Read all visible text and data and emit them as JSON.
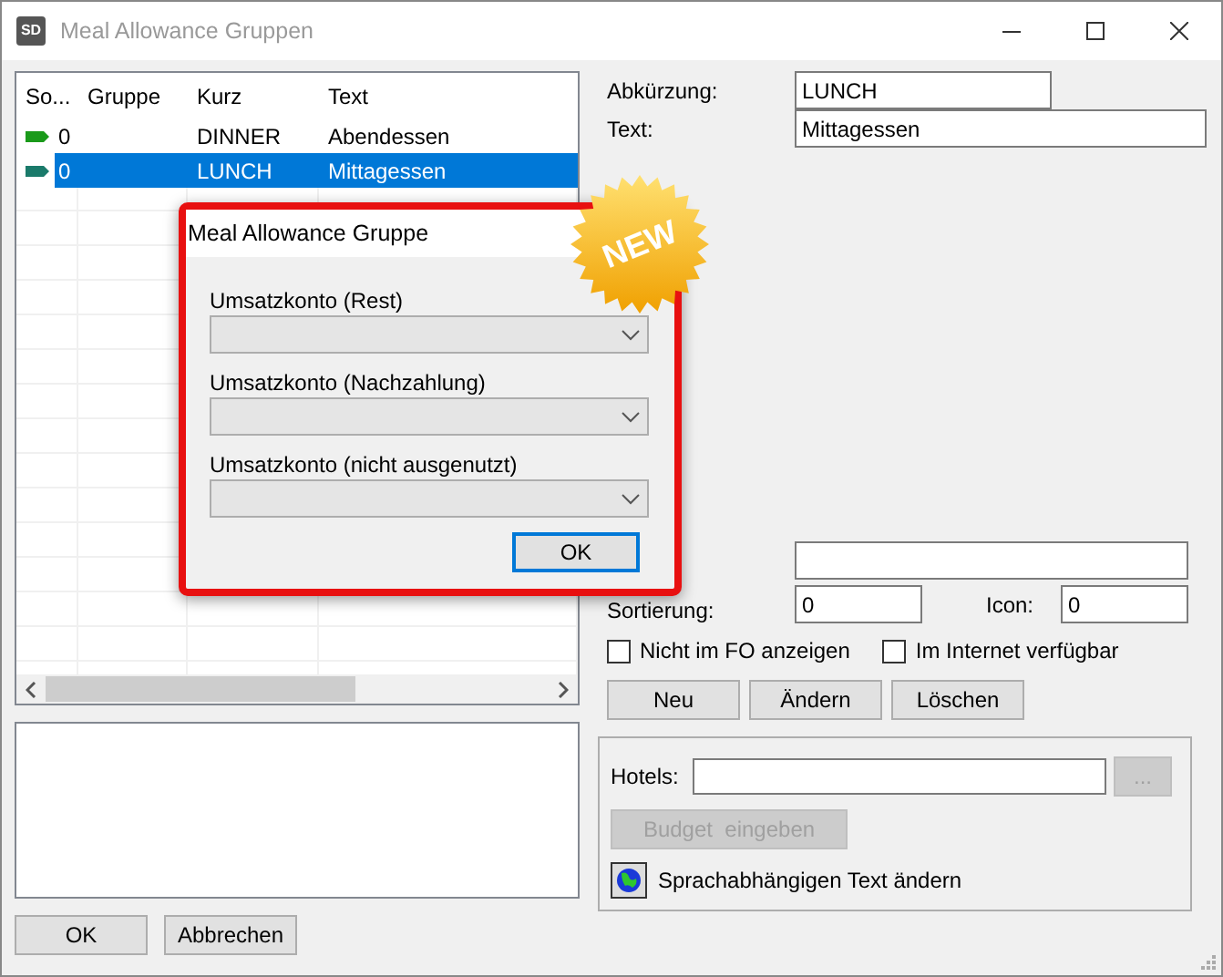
{
  "window": {
    "title": "Meal Allowance Gruppen",
    "icon_text": "SD"
  },
  "table": {
    "columns": [
      "So...",
      "Gruppe",
      "Kurz",
      "Text"
    ],
    "rows": [
      {
        "so": "0",
        "kurz": "DINNER",
        "text": "Abendessen",
        "selected": false
      },
      {
        "so": "0",
        "kurz": "LUNCH",
        "text": "Mittagessen",
        "selected": true
      }
    ]
  },
  "form": {
    "abbreviation": {
      "label": "Abkürzung:",
      "value": "LUNCH"
    },
    "text": {
      "label": "Text:",
      "value": "Mittagessen"
    },
    "sorting": {
      "label": "Sortierung:",
      "value": "0"
    },
    "icon": {
      "label": "Icon:",
      "value": "0"
    },
    "checkboxes": [
      {
        "label": "Nicht im FO anzeigen",
        "checked": false
      },
      {
        "label": "Im Internet verfügbar",
        "checked": false
      }
    ],
    "buttons": [
      "Neu",
      "Ändern",
      "Löschen"
    ]
  },
  "group": {
    "hotels_label": "Hotels:",
    "browse_button": {
      "label": "...",
      "disabled": true
    },
    "budget_button": {
      "label": "Budget  eingeben",
      "disabled": true
    },
    "language_text_label": "Sprachabhängigen Text ändern"
  },
  "footer_buttons": [
    "OK",
    "Abbrechen"
  ],
  "dialog": {
    "title": "Meal Allowance Gruppe",
    "fields": [
      {
        "label": "Umsatzkonto (Rest)"
      },
      {
        "label": "Umsatzkonto (Nachzahlung)"
      },
      {
        "label": "Umsatzkonto (nicht ausgenutzt)"
      }
    ],
    "ok_button": "OK"
  },
  "badge": "NEW"
}
